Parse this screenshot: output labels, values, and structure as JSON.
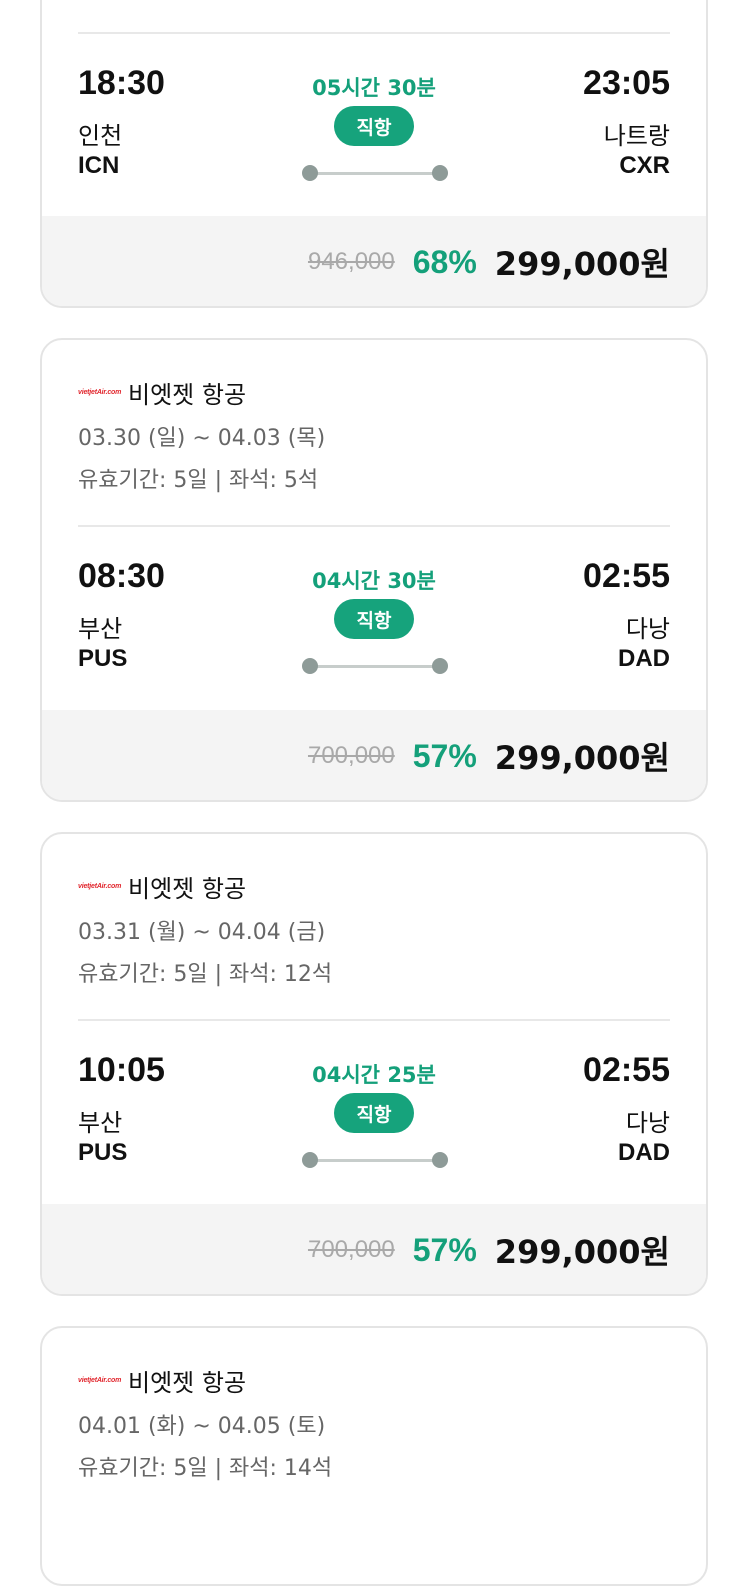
{
  "cards": [
    {
      "flight": {
        "dep_time": "18:30",
        "dep_city": "인천",
        "dep_code": "ICN",
        "duration": "05시간 30분",
        "badge": "직항",
        "arr_time": "23:05",
        "arr_city": "나트랑",
        "arr_code": "CXR"
      },
      "price": {
        "original": "946,000",
        "discount": "68%",
        "final": "299,000원"
      }
    },
    {
      "airline": {
        "logo": "vietjetAir.com",
        "name": "비엣젯 항공"
      },
      "dates": "03.30 (일) ~ 04.03 (목)",
      "validity": "유효기간: 5일 | 좌석: 5석",
      "flight": {
        "dep_time": "08:30",
        "dep_city": "부산",
        "dep_code": "PUS",
        "duration": "04시간 30분",
        "badge": "직항",
        "arr_time": "02:55",
        "arr_city": "다낭",
        "arr_code": "DAD"
      },
      "price": {
        "original": "700,000",
        "discount": "57%",
        "final": "299,000원"
      }
    },
    {
      "airline": {
        "logo": "vietjetAir.com",
        "name": "비엣젯 항공"
      },
      "dates": "03.31 (월) ~ 04.04 (금)",
      "validity": "유효기간: 5일 | 좌석: 12석",
      "flight": {
        "dep_time": "10:05",
        "dep_city": "부산",
        "dep_code": "PUS",
        "duration": "04시간 25분",
        "badge": "직항",
        "arr_time": "02:55",
        "arr_city": "다낭",
        "arr_code": "DAD"
      },
      "price": {
        "original": "700,000",
        "discount": "57%",
        "final": "299,000원"
      }
    },
    {
      "airline": {
        "logo": "vietjetAir.com",
        "name": "비엣젯 항공"
      },
      "dates": "04.01 (화) ~ 04.05 (토)",
      "validity": "유효기간: 5일 | 좌석: 14석"
    }
  ],
  "colors": {
    "accent": "#16a37c",
    "accent_text": "#14a07a",
    "logo_red": "#e1262d"
  }
}
